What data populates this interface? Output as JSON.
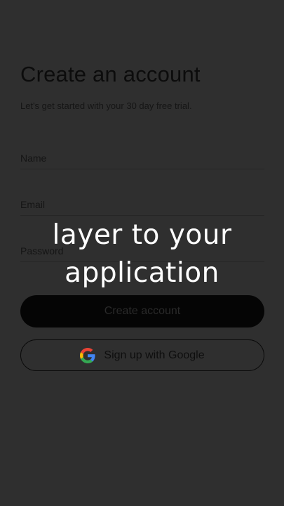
{
  "signup": {
    "title": "Create an account",
    "subtitle": "Let's get started with your 30 day free trial.",
    "fields": {
      "name_placeholder": "Name",
      "email_placeholder": "Email",
      "password_placeholder": "Password"
    },
    "create_button_label": "Create account",
    "google_button_label": "Sign up with Google"
  },
  "caption": {
    "line1": "layer to your",
    "line2": "application"
  },
  "icons": {
    "google": "google-logo-icon"
  },
  "colors": {
    "background": "#2f2f2f",
    "primary_button": "#050505",
    "caption_text": "#ffffff",
    "google_blue": "#4285F4",
    "google_red": "#EA4335",
    "google_yellow": "#FBBC05",
    "google_green": "#34A853"
  }
}
